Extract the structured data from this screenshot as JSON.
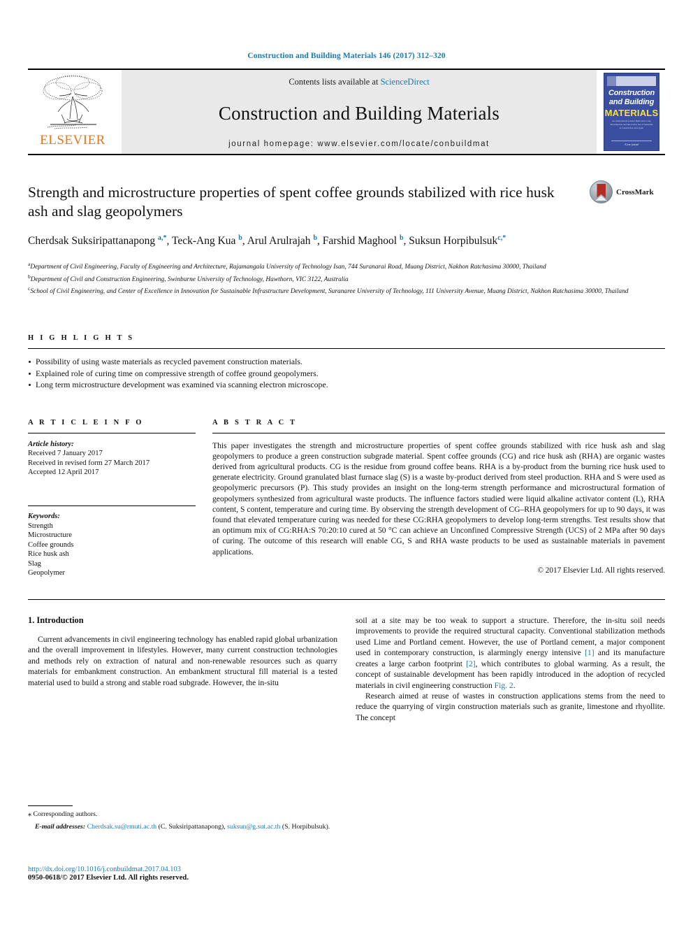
{
  "running_head": "Construction and Building Materials 146 (2017) 312–320",
  "masthead": {
    "publisher_name": "ELSEVIER",
    "contents_prefix": "Contents lists available at",
    "contents_link": "ScienceDirect",
    "journal_title": "Construction and Building Materials",
    "homepage": "journal homepage: www.elsevier.com/locate/conbuildmat",
    "cover": {
      "line1": "Construction",
      "line2": "and Building",
      "line3": "MATERIALS",
      "blurb": "An international journal Dedicated to the investigation and innovative use of materials in construction and repair",
      "footer": "A free journal"
    }
  },
  "article": {
    "title": "Strength and microstructure properties of spent coffee grounds stabilized with rice husk ash and slag geopolymers",
    "authors_html": "Cherdsak Suksiripattanapong <sup>a,*</sup>, Teck-Ang Kua <sup>b</sup>, Arul Arulrajah <sup>b</sup>, Farshid Maghool <sup>b</sup>, Suksun Horpibulsuk<sup>c,*</sup>",
    "crossmark_label": "CrossMark",
    "affiliations": [
      "Department of Civil Engineering, Faculty of Engineering and Architecture, Rajamangala University of Technology Isan, 744 Suranarai Road, Muang District, Nakhon Ratchasima 30000, Thailand",
      "Department of Civil and Construction Engineering, Swinburne University of Technology, Hawthorn, VIC 3122, Australia",
      "School of Civil Engineering, and Center of Excellence in Innovation for Sustainable Infrastructure Development, Suranaree University of Technology, 111 University Avenue, Muang District, Nakhon Ratchasima 30000, Thailand"
    ],
    "affiliation_marks": [
      "a",
      "b",
      "c"
    ]
  },
  "highlights": {
    "heading": "H I G H L I G H T S",
    "items": [
      "Possibility of using waste materials as recycled pavement construction materials.",
      "Explained role of curing time on compressive strength of coffee ground geopolymers.",
      "Long term microstructure development was examined via scanning electron microscope."
    ]
  },
  "article_info": {
    "heading": "A R T I C L E  I N F O",
    "history_label": "Article history:",
    "history": [
      "Received 7 January 2017",
      "Received in revised form 27 March 2017",
      "Accepted 12 April 2017"
    ],
    "keywords_label": "Keywords:",
    "keywords": [
      "Strength",
      "Microstructure",
      "Coffee grounds",
      "Rice husk ash",
      "Slag",
      "Geopolymer"
    ]
  },
  "abstract": {
    "heading": "A B S T R A C T",
    "text": "This paper investigates the strength and microstructure properties of spent coffee grounds stabilized with rice husk ash and slag geopolymers to produce a green construction subgrade material. Spent coffee grounds (CG) and rice husk ash (RHA) are organic wastes derived from agricultural products. CG is the residue from ground coffee beans. RHA is a by-product from the burning rice husk used to generate electricity. Ground granulated blast furnace slag (S) is a waste by-product derived from steel production. RHA and S were used as geopolymeric precursors (P). This study provides an insight on the long-term strength performance and microstructural formation of geopolymers synthesized from agricultural waste products. The influence factors studied were liquid alkaline activator content (L), RHA content, S content, temperature and curing time. By observing the strength development of CG–RHA geopolymers for up to 90 days, it was found that elevated temperature curing was needed for these CG:RHA geopolymers to develop long-term strengths. Test results show that an optimum mix of CG:RHA:S 70:20:10 cured at 50 °C can achieve an Unconfined Compressive Strength (UCS) of 2 MPa after 90 days of curing. The outcome of this research will enable CG, S and RHA waste products to be used as sustainable materials in pavement applications.",
    "copyright": "© 2017 Elsevier Ltd. All rights reserved."
  },
  "introduction": {
    "number_title": "1. Introduction",
    "col_left_p1": "Current advancements in civil engineering technology has enabled rapid global urbanization and the overall improvement in lifestyles. However, many current construction technologies and methods rely on extraction of natural and non-renewable resources such as quarry materials for embankment construction. An embankment structural fill material is a tested material used to build a strong and stable road subgrade. However, the in-situ",
    "col_right_p1_a": "soil at a site may be too weak to support a structure. Therefore, the in-situ soil needs improvements to provide the required structural capacity. Conventional stabilization methods used Lime and Portland cement. However, the use of Portland cement, a major component used in contemporary construction, is alarmingly energy intensive ",
    "ref1": "[1]",
    "col_right_p1_b": " and its manufacture creates a large carbon footprint ",
    "ref2": "[2]",
    "col_right_p1_c": ", which contributes to global warming. As a result, the concept of sustainable development has been rapidly introduced in the adoption of recycled materials in civil engineering construction ",
    "fig_ref": "Fig. 2",
    "col_right_p1_d": ".",
    "col_right_p2": "Research aimed at reuse of wastes in construction applications stems from the need to reduce the quarrying of virgin construction materials such as granite, limestone and rhyollite. The concept"
  },
  "footer": {
    "corresponding": "Corresponding authors.",
    "email_label": "E-mail addresses:",
    "email1": "Cherdsak.su@rmuti.ac.th",
    "email1_owner": "(C. Suksiripattanapong),",
    "email2": "suksun@g.sut.ac.th",
    "email2_owner": "(S. Horpibulsuk).",
    "doi": "http://dx.doi.org/10.1016/j.conbuildmat.2017.04.103",
    "issn": "0950-0618/© 2017 Elsevier Ltd. All rights reserved."
  },
  "colors": {
    "link_blue": "#1a7bb0",
    "elsevier_orange": "#e8761a",
    "cover_blue": "#3b4fa0",
    "crossmark_red": "#b32b22"
  }
}
